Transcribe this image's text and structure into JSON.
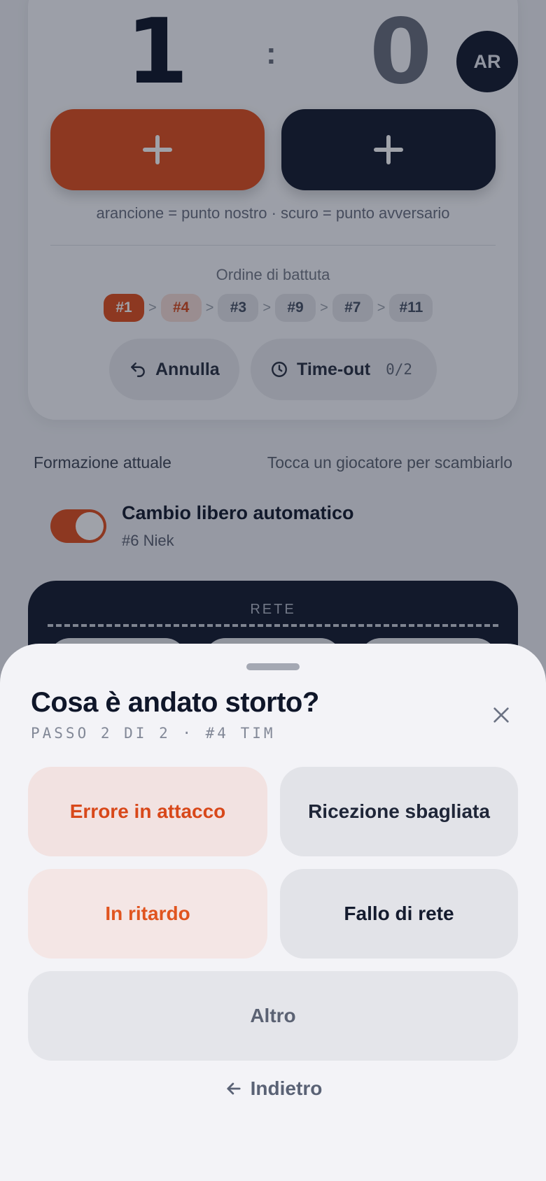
{
  "score": {
    "home": "1",
    "separator": ":",
    "away": "0"
  },
  "avatar": {
    "initials": "AR"
  },
  "hint": "arancione = punto nostro · scuro = punto avversario",
  "serve_order": {
    "title": "Ordine di battuta",
    "players": [
      "#1",
      "#4",
      "#3",
      "#9",
      "#7",
      "#11"
    ],
    "separator": ">"
  },
  "actions": {
    "undo_label": "Annulla",
    "timeout_label": "Time-out",
    "timeout_count": "0/2"
  },
  "lineup": {
    "label": "Formazione attuale",
    "hint": "Tocca un giocatore per scambiarlo"
  },
  "libero": {
    "title": "Cambio libero automatico",
    "player": "#6 Niek",
    "enabled": true
  },
  "court": {
    "net_label": "RETE"
  },
  "sheet": {
    "title": "Cosa è andato storto?",
    "step": "PASSO 2 DI 2 · #4 TIM",
    "options": [
      "Errore in attacco",
      "Ricezione sbagliata",
      "In ritardo",
      "Fallo di rete",
      "Altro"
    ],
    "back_label": "Indietro"
  },
  "colors": {
    "accent": "#e24f1d",
    "dark": "#141b2e",
    "sheet_bg": "#f3f3f7"
  },
  "icons": {
    "undo": "undo-icon",
    "timeout": "clock-icon",
    "close": "close-icon",
    "back": "arrow-left-icon"
  }
}
